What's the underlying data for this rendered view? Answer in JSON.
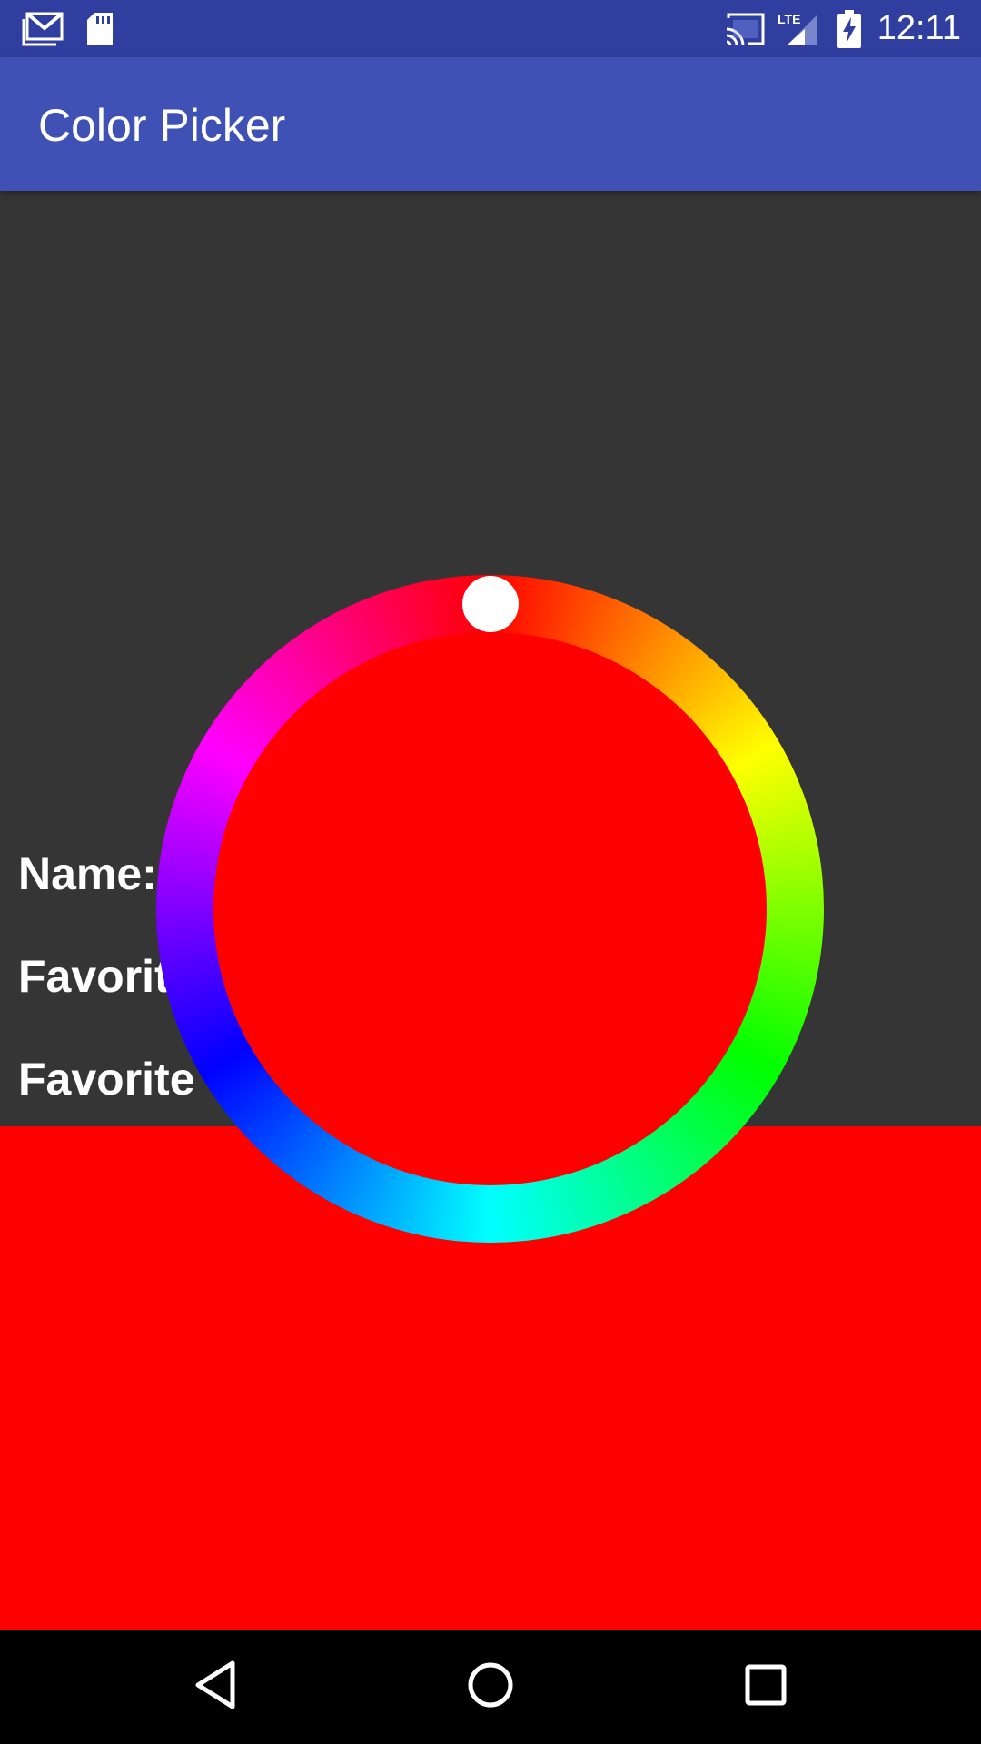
{
  "status_bar": {
    "time": "12:11",
    "left_icons": [
      "gmail-icon",
      "sd-card-icon"
    ],
    "right_icons": [
      "cast-icon",
      "lte-signal-icon",
      "battery-charging-icon"
    ],
    "network_label": "LTE",
    "background": "#303f9f"
  },
  "app_bar": {
    "title": "Color Picker",
    "background": "#3f51b5"
  },
  "form": {
    "labels": [
      "Name:",
      "Favorit",
      "Favorite"
    ]
  },
  "color_picker": {
    "selected_color": "#ff0000",
    "hue_degrees": 0,
    "ring_colors": [
      "#ff0000",
      "#ffff00",
      "#00ff00",
      "#00ffff",
      "#0000ff",
      "#ff00ff"
    ]
  },
  "preview": {
    "color": "#ff0000"
  },
  "nav_bar": {
    "buttons": [
      "back-icon",
      "home-icon",
      "recents-icon"
    ]
  }
}
